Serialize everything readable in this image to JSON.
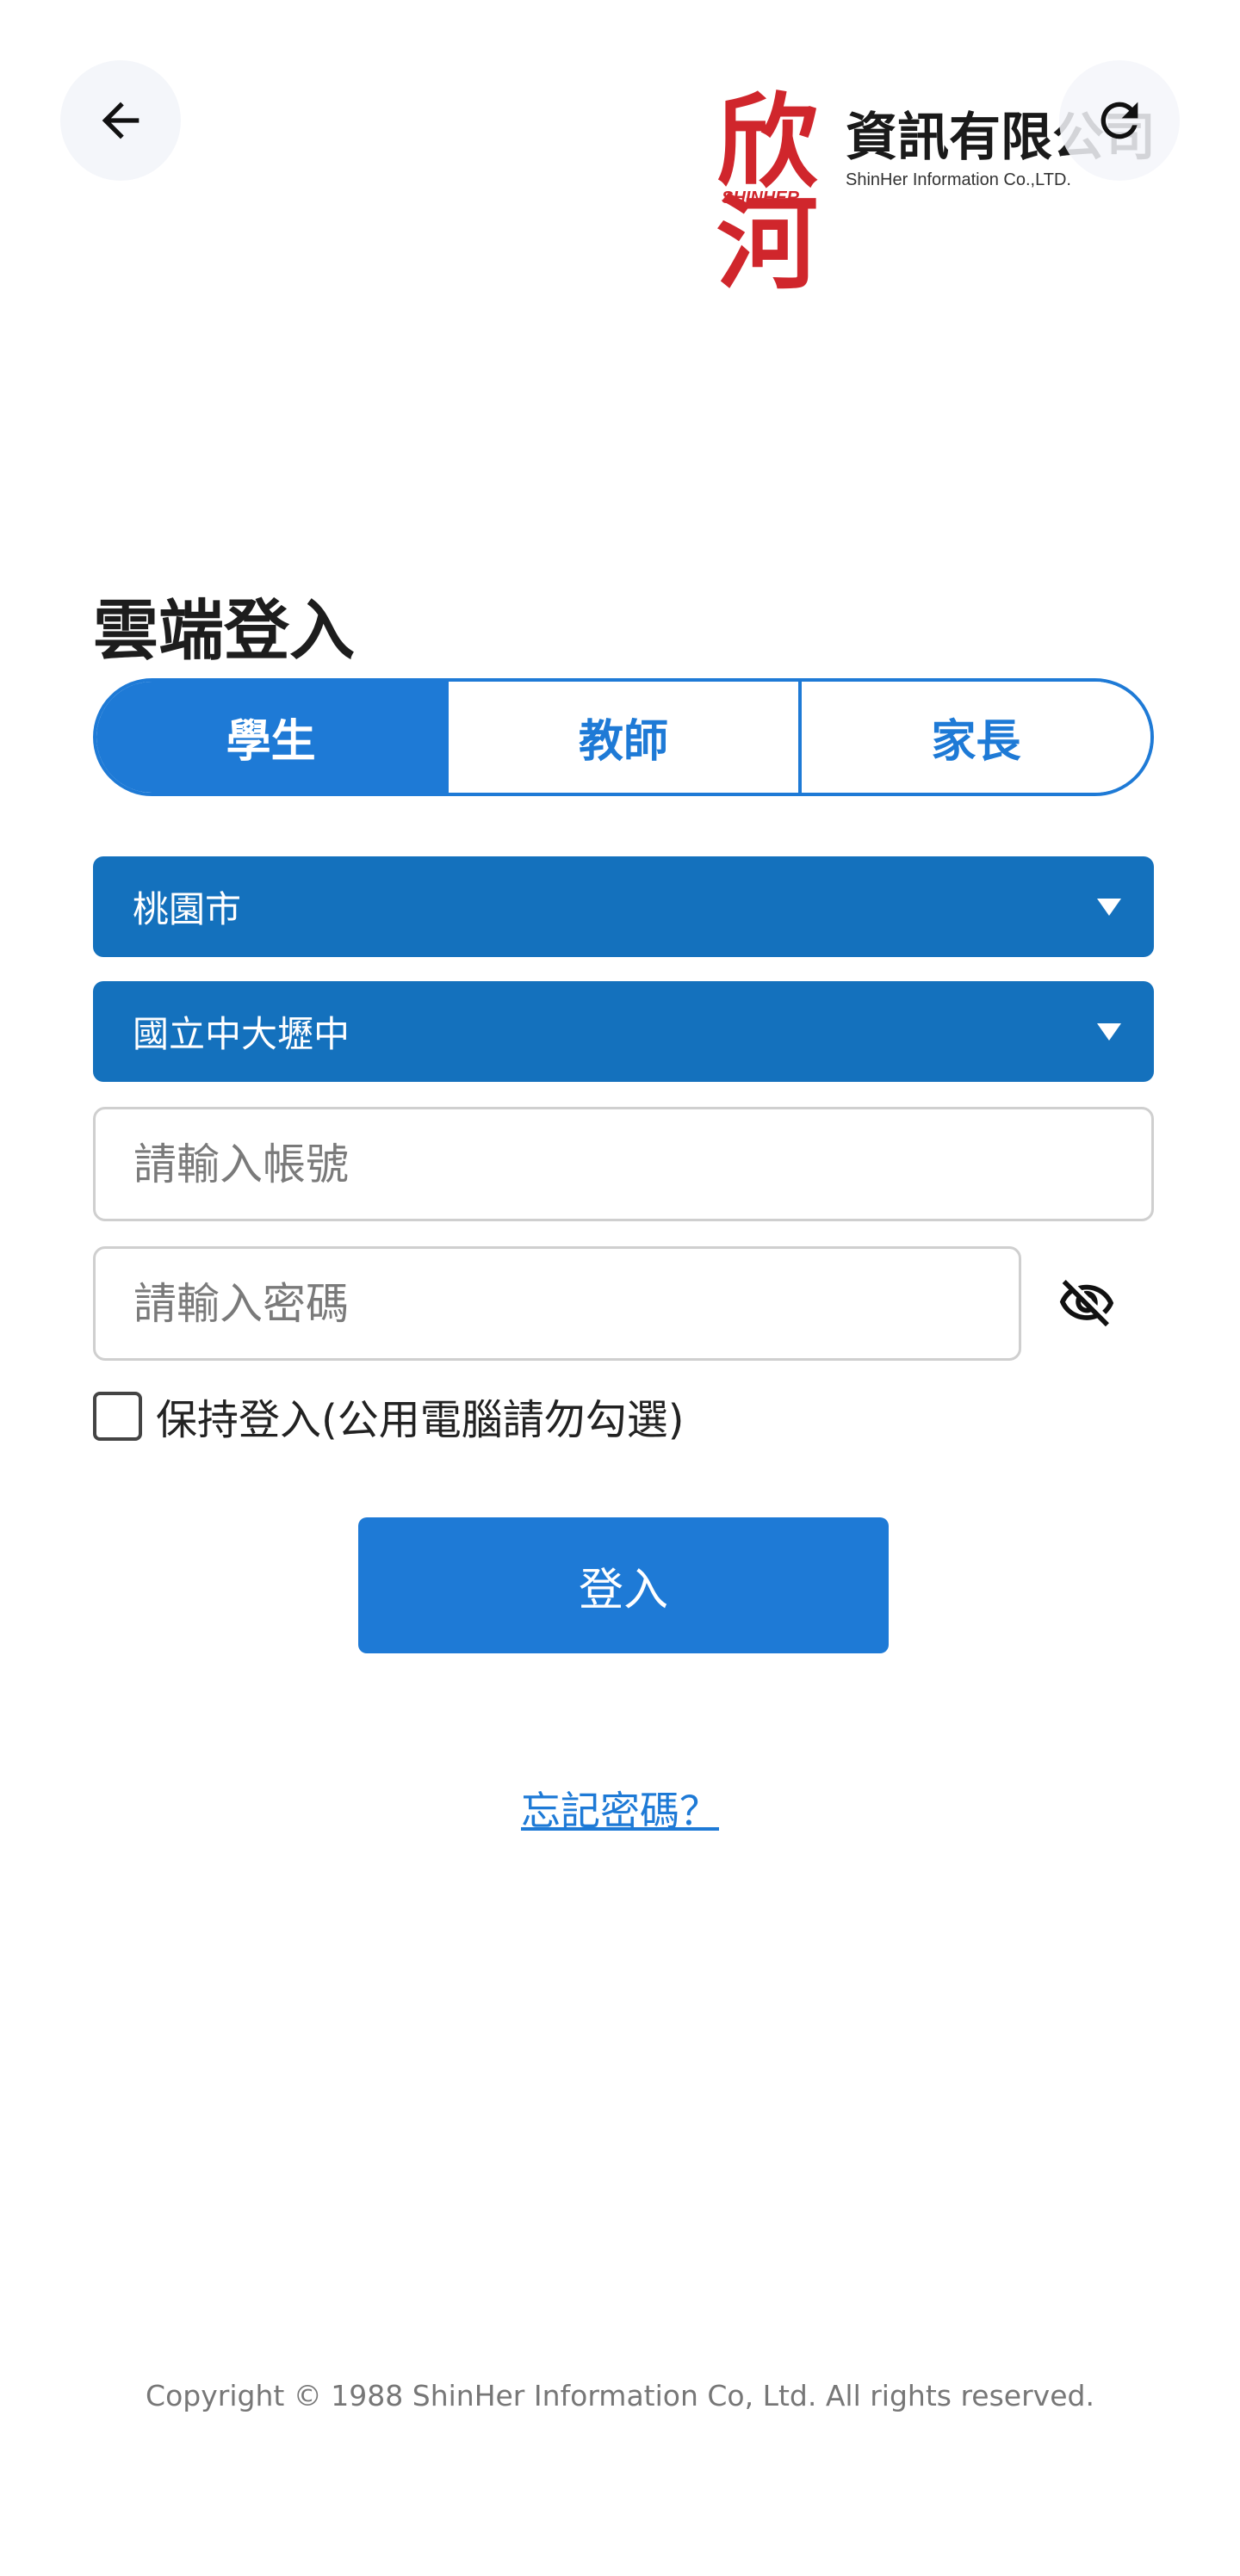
{
  "header": {
    "back_icon": "arrow-left-icon",
    "refresh_icon": "refresh-icon",
    "logo": {
      "mark": "欣河",
      "tagline": "SHINHER",
      "name_zh": "資訊有限公司",
      "name_en": "ShinHer Information Co.,LTD."
    }
  },
  "login": {
    "title": "雲端登入",
    "roles": [
      {
        "label": "學生",
        "active": true
      },
      {
        "label": "教師",
        "active": false
      },
      {
        "label": "家長",
        "active": false
      }
    ],
    "city_select": {
      "value": "桃園市"
    },
    "school_select": {
      "value": "國立中大壢中"
    },
    "account": {
      "placeholder": "請輸入帳號",
      "value": ""
    },
    "password": {
      "placeholder": "請輸入密碼",
      "value": ""
    },
    "toggle_visibility_icon": "eye-off-icon",
    "remember_label": "保持登入(公用電腦請勿勾選)",
    "remember_checked": false,
    "submit_label": "登入",
    "forgot_label": "忘記密碼？"
  },
  "footer": {
    "copyright": "Copyright © 1988 ShinHer Information Co, Ltd. All rights reserved."
  },
  "colors": {
    "primary": "#1e7ad6",
    "select_bg": "#1471bd",
    "logo_red": "#d0262c"
  }
}
